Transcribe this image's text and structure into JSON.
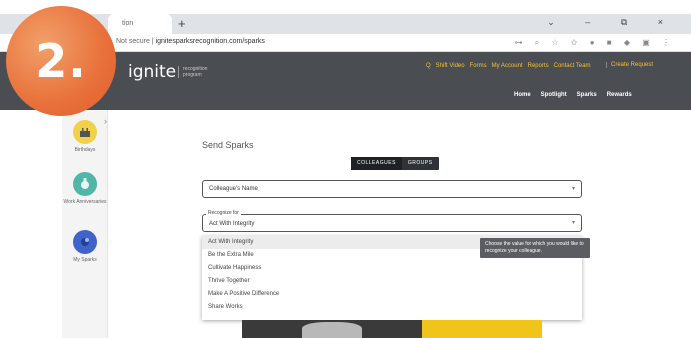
{
  "step": "2.",
  "browser": {
    "tab_title": "tion",
    "new_tab": "+",
    "window_controls": "⌄ – ⧉ ×",
    "url_prefix": "Not secure |",
    "url": "ignitesparksrecognition.com/sparks",
    "toolbar_icons": "⊶ ⌕ ☆ ✩ ● ■ ◆ ▣ ⋮"
  },
  "header": {
    "logo": "ignite",
    "logo_tagline": "recognition\nprogram",
    "top_nav": [
      "Q",
      "Shift Video",
      "Forms",
      "My Account",
      "Reports",
      "Contact Team"
    ],
    "cta": "Create Request",
    "main_nav": [
      "Home",
      "Spotlight",
      "Sparks",
      "Rewards"
    ]
  },
  "sidebar": {
    "items": [
      {
        "label": "Birthdays",
        "icon": "cake-icon",
        "color": "#f2d04a"
      },
      {
        "label": "Work Anniversaries",
        "icon": "medal-icon",
        "color": "#4fb6a8"
      },
      {
        "label": "My Sparks",
        "icon": "sparks-icon",
        "color": "#3f63c9"
      }
    ]
  },
  "main": {
    "title": "Send Sparks",
    "toggle": [
      "COLLEAGUES",
      "GROUPS"
    ],
    "colleague_select": "Colleague's Name",
    "value_label": "Recognize for",
    "value_select": "Act With Integrity",
    "options": [
      "Act With Integrity",
      "Be the Extra Mile",
      "Cultivate Happiness",
      "Thrive Together",
      "Make A Positive Difference",
      "Share Works"
    ],
    "tooltip": "Choose the value for which you would like to recognize your colleague."
  },
  "colors": {
    "header_bg": "#4a4d52",
    "accent": "#f1c232",
    "badge": "#e8703a"
  }
}
